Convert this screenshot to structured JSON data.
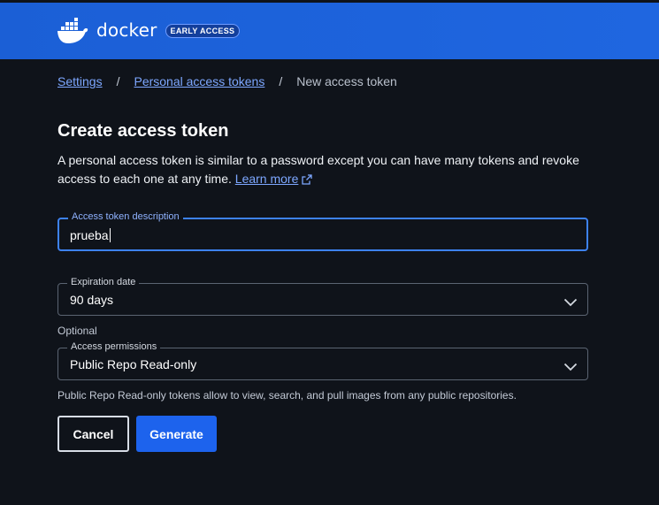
{
  "header": {
    "brand": "docker",
    "badge": "EARLY ACCESS",
    "colors": {
      "bar": "#1d63ed",
      "badge_bg": "#133f9c"
    }
  },
  "breadcrumb": {
    "items": [
      "Settings",
      "Personal access tokens"
    ],
    "separator": "/",
    "current": "New access token"
  },
  "page": {
    "title": "Create access token",
    "description": "A personal access token is similar to a password except you can have many tokens and revoke access to each one at any time.",
    "learn_more": "Learn more"
  },
  "form": {
    "description_field": {
      "label": "Access token description",
      "value": "prueba"
    },
    "expiration_field": {
      "label": "Expiration date",
      "value": "90 days"
    },
    "optional_label": "Optional",
    "permissions_field": {
      "label": "Access permissions",
      "value": "Public Repo Read-only"
    },
    "permissions_help": "Public Repo Read-only tokens allow to view, search, and pull images from any public repositories."
  },
  "actions": {
    "cancel": "Cancel",
    "generate": "Generate"
  },
  "icons": {
    "logo": "docker-whale-icon",
    "external": "external-link-icon",
    "dropdown": "chevron-down-icon"
  }
}
